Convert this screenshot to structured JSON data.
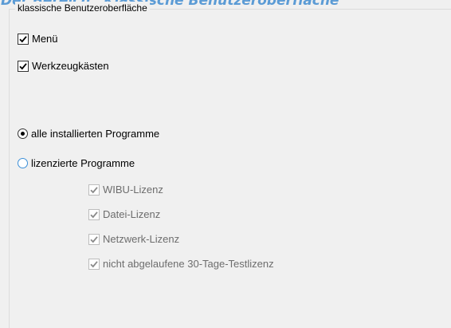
{
  "page_title": "Der Bereich „Klassische Benutzeroberfläche“",
  "group": {
    "legend": "klassische Benutzeroberfläche",
    "checkboxes": [
      {
        "label": "Menü",
        "checked": true
      },
      {
        "label": "Werkzeugkästen",
        "checked": true
      }
    ],
    "radios": [
      {
        "label": "alle installierten Programme",
        "selected": true
      },
      {
        "label": "lizenzierte Programme",
        "selected": false
      }
    ],
    "license_options": [
      {
        "label": "WIBU-Lizenz",
        "checked": true,
        "enabled": false
      },
      {
        "label": "Datei-Lizenz",
        "checked": true,
        "enabled": false
      },
      {
        "label": "Netzwerk-Lizenz",
        "checked": true,
        "enabled": false
      },
      {
        "label": "nicht abgelaufene 30-Tage-Testlizenz",
        "checked": true,
        "enabled": false
      }
    ]
  },
  "colors": {
    "title_blue": "#5b9bd5",
    "background": "#f0f0f0",
    "radio_unselected_border": "#3c8fd8",
    "disabled_text": "#6d6d6d"
  }
}
